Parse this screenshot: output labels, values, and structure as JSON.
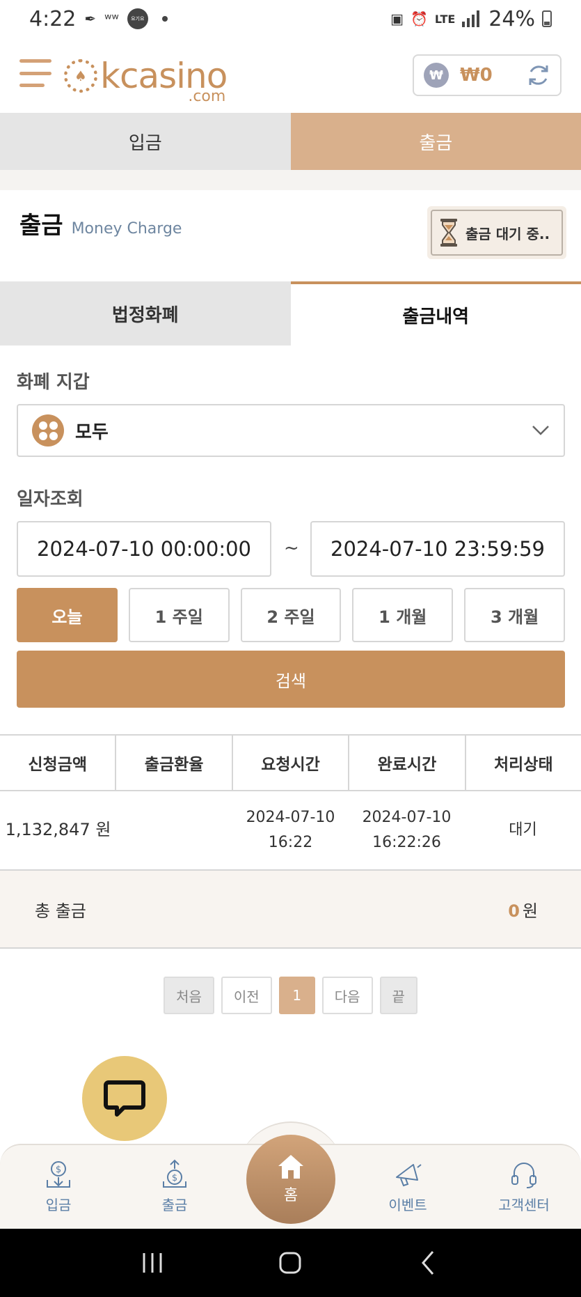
{
  "status_bar": {
    "time": "4:22",
    "notif_badge": "요기요",
    "network": "LTE",
    "battery": "24%"
  },
  "header": {
    "logo_text": "kcasino",
    "logo_suffix": ".com",
    "balance_currency": "₩",
    "balance": "₩0"
  },
  "main_tabs": [
    {
      "label": "입금",
      "active": false
    },
    {
      "label": "출금",
      "active": true
    }
  ],
  "section": {
    "title": "출금",
    "subtitle": "Money Charge",
    "pending_label": "출금 대기 중.."
  },
  "sub_tabs": [
    {
      "label": "법정화폐",
      "active": false
    },
    {
      "label": "출금내역",
      "active": true
    }
  ],
  "wallet": {
    "label": "화폐 지갑",
    "selected": "모두"
  },
  "date_query": {
    "label": "일자조회",
    "start": "2024-07-10 00:00:00",
    "separator": "~",
    "end": "2024-07-10 23:59:59",
    "periods": [
      "오늘",
      "1 주일",
      "2 주일",
      "1 개월",
      "3 개월"
    ],
    "selected_period": "오늘",
    "search_label": "검색"
  },
  "table": {
    "headers": [
      "신청금액",
      "출금환율",
      "요청시간",
      "완료시간",
      "처리상태"
    ],
    "rows": [
      {
        "amount": "1,132,847 원",
        "rate": "",
        "requested_date": "2024-07-10",
        "requested_time": "16:22",
        "completed_date": "2024-07-10",
        "completed_time": "16:22:26",
        "status": "대기"
      }
    ],
    "total_label": "총 출금",
    "total_value": "0",
    "total_unit": "원"
  },
  "pagination": {
    "first": "처음",
    "prev": "이전",
    "current": "1",
    "next": "다음",
    "last": "끝"
  },
  "bottom_nav": {
    "deposit": "입금",
    "withdraw": "출금",
    "home": "홈",
    "event": "이벤트",
    "support": "고객센터"
  },
  "colors": {
    "accent": "#c8915d",
    "tab_active": "#d9b08c",
    "nav_text": "#5a7ea6",
    "chat": "#e8c878"
  }
}
